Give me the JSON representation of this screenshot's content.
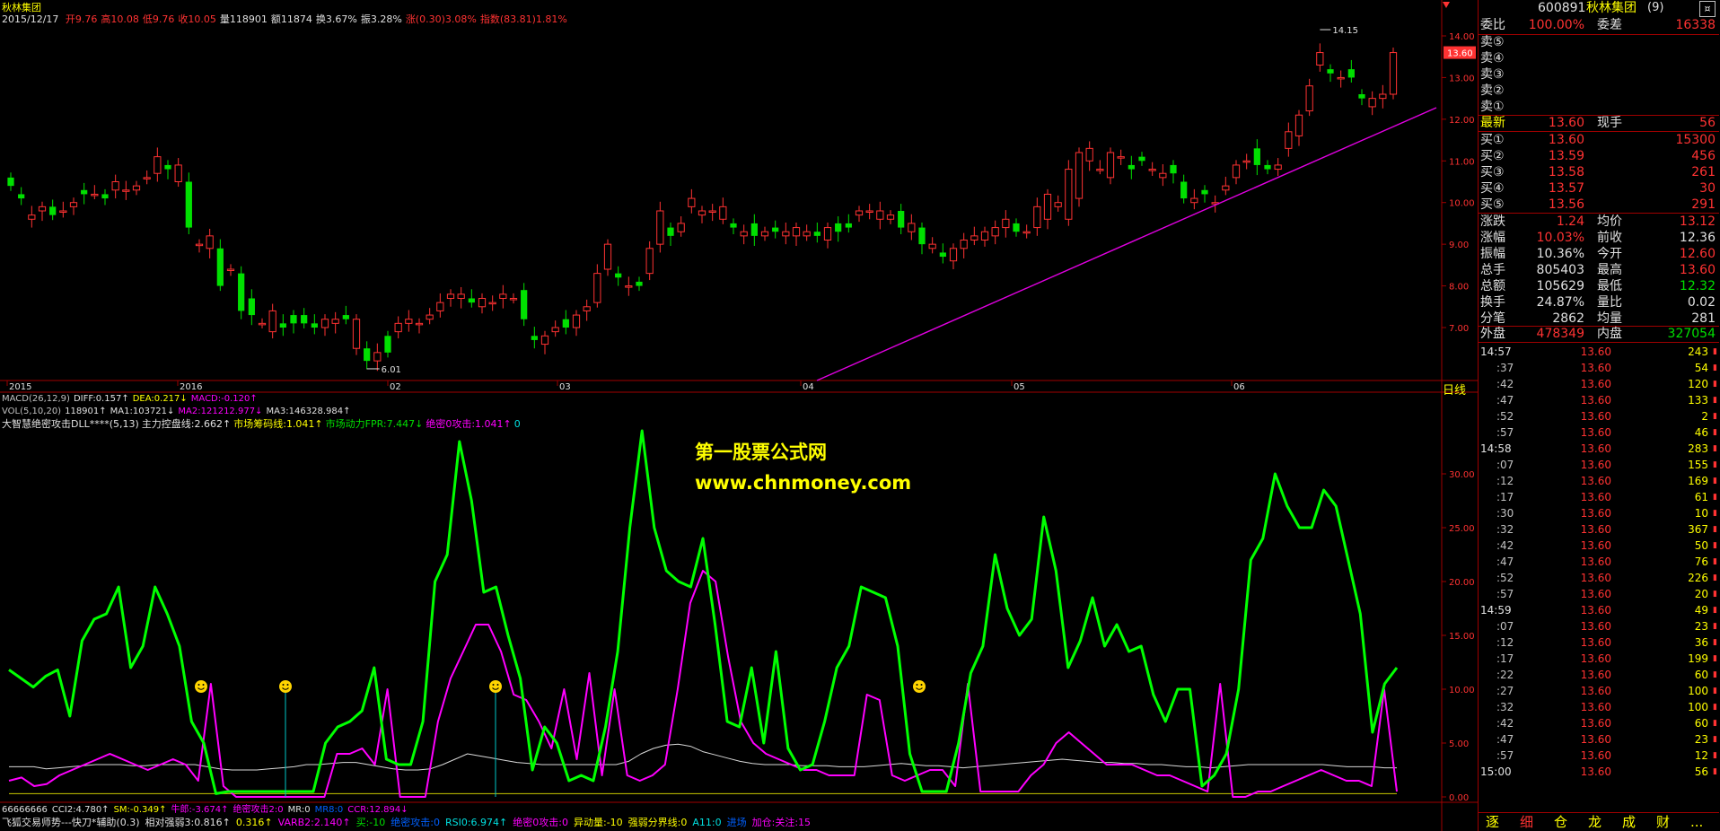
{
  "header": {
    "name": "秋林集团",
    "date": "2015/12/17",
    "fields": [
      {
        "label": "开9.76",
        "color": "#ff3232"
      },
      {
        "label": "高10.08",
        "color": "#ff3232"
      },
      {
        "label": "低9.76",
        "color": "#ff3232"
      },
      {
        "label": "收10.05",
        "color": "#ff3232"
      },
      {
        "label": "量118901",
        "color": "#e0e0e0"
      },
      {
        "label": "额11874",
        "color": "#e0e0e0"
      },
      {
        "label": "换3.67%",
        "color": "#e0e0e0"
      },
      {
        "label": "振3.28%",
        "color": "#e0e0e0"
      },
      {
        "label": "涨(0.30)3.08%",
        "color": "#ff3232"
      },
      {
        "label": "指数(83.81)1.81%",
        "color": "#ff3232"
      }
    ]
  },
  "price_axis": {
    "labels": [
      "14.00",
      "13.00",
      "12.00",
      "11.00",
      "10.00",
      "9.00",
      "8.00",
      "7.00"
    ],
    "current_tag": "13.60",
    "high_label": "14.15",
    "low_label": "6.01"
  },
  "date_axis": {
    "labels": [
      "2015",
      "2016",
      "02",
      "03",
      "04",
      "05",
      "06"
    ],
    "period": "日线"
  },
  "macd_line": [
    {
      "text": "MACD(26,12,9)",
      "color": "#c0c0c0"
    },
    {
      "text": "DIFF:0.157↑",
      "color": "#e0e0e0"
    },
    {
      "text": "DEA:0.217↓",
      "color": "#ffff00"
    },
    {
      "text": "MACD:-0.120↑",
      "color": "#ff00ff"
    }
  ],
  "vol_line": [
    {
      "text": "VOL(5,10,20)",
      "color": "#c0c0c0"
    },
    {
      "text": "118901↑",
      "color": "#e0e0e0"
    },
    {
      "text": "MA1:103721↓",
      "color": "#e0e0e0"
    },
    {
      "text": "MA2:121212.977↓",
      "color": "#ff00ff"
    },
    {
      "text": "MA3:146328.984↑",
      "color": "#e0e0e0"
    }
  ],
  "indicator_line": [
    {
      "text": "大智慧绝密攻击DLL****(5,13)",
      "color": "#e0e0e0"
    },
    {
      "text": "主力控盘线:2.662↑",
      "color": "#e0e0e0"
    },
    {
      "text": "市场筹码线:1.041↑",
      "color": "#ffff00"
    },
    {
      "text": "市场动力FPR:7.447↓",
      "color": "#00e000"
    },
    {
      "text": "绝密0攻击:1.041↑",
      "color": "#ff00ff"
    },
    {
      "text": "0",
      "color": "#00e0e0"
    }
  ],
  "indicator_axis": {
    "labels": [
      "30.00",
      "25.00",
      "20.00",
      "15.00",
      "10.00",
      "5.00",
      "0.00"
    ]
  },
  "watermark": {
    "line1": "第一股票公式网",
    "line2": "www.chnmoney.com"
  },
  "bottom_line1": [
    {
      "text": "66666666",
      "color": "#e0e0e0"
    },
    {
      "text": "CCI2:4.780↑",
      "color": "#e0e0e0"
    },
    {
      "text": "SM:-0.349↑",
      "color": "#ffff00"
    },
    {
      "text": "牛郎:-3.674↑",
      "color": "#ff00ff"
    },
    {
      "text": "绝密攻击2:0",
      "color": "#ff00ff"
    },
    {
      "text": "MR:0",
      "color": "#e0e0e0"
    },
    {
      "text": "MR8:0",
      "color": "#0060ff"
    },
    {
      "text": "CCR:12.894↓",
      "color": "#ff00ff"
    }
  ],
  "bottom_line2": [
    {
      "text": "飞狐交易师势---快刀*辅助(0.3)",
      "color": "#e0e0e0"
    },
    {
      "text": "相对强弱3:0.816↑",
      "color": "#e0e0e0"
    },
    {
      "text": "0.316↑",
      "color": "#ffff00"
    },
    {
      "text": "VARB2:2.140↑",
      "color": "#ff00ff"
    },
    {
      "text": "买:-10",
      "color": "#00e000"
    },
    {
      "text": "绝密攻击:0",
      "color": "#0060ff"
    },
    {
      "text": "RSI0:6.974↑",
      "color": "#00e0e0"
    },
    {
      "text": "绝密0攻击:0",
      "color": "#ff00ff"
    },
    {
      "text": "异动量:-10",
      "color": "#ffff00"
    },
    {
      "text": "强弱分界线:0",
      "color": "#ffff00"
    },
    {
      "text": "A11:0",
      "color": "#00e0e0"
    },
    {
      "text": "进场",
      "color": "#0060ff"
    },
    {
      "text": "加仓:关注:15",
      "color": "#ff00ff"
    }
  ],
  "right_panel": {
    "code": "600891",
    "name": "秋林集团",
    "suffix": "(9)",
    "corner": "¤",
    "weibi_label": "委比",
    "weibi_value": "100.00%",
    "weicha_label": "委差",
    "weicha_value": "16338",
    "sell_levels": [
      "卖⑤",
      "卖④",
      "卖③",
      "卖②",
      "卖①"
    ],
    "latest": {
      "label": "最新",
      "value": "13.60",
      "label2": "现手",
      "value2": "56"
    },
    "buy_levels": [
      {
        "label": "买①",
        "price": "13.60",
        "vol": "15300"
      },
      {
        "label": "买②",
        "price": "13.59",
        "vol": "456"
      },
      {
        "label": "买③",
        "price": "13.58",
        "vol": "261"
      },
      {
        "label": "买④",
        "price": "13.57",
        "vol": "30"
      },
      {
        "label": "买⑤",
        "price": "13.56",
        "vol": "291"
      }
    ],
    "stats": [
      {
        "l1": "涨跌",
        "v1": "1.24",
        "c1": "#ff3232",
        "l2": "均价",
        "v2": "13.12",
        "c2": "#ff3232"
      },
      {
        "l1": "涨幅",
        "v1": "10.03%",
        "c1": "#ff3232",
        "l2": "前收",
        "v2": "12.36",
        "c2": "#e0e0e0"
      },
      {
        "l1": "振幅",
        "v1": "10.36%",
        "c1": "#e0e0e0",
        "l2": "今开",
        "v2": "12.60",
        "c2": "#ff3232"
      },
      {
        "l1": "总手",
        "v1": "805403",
        "c1": "#e0e0e0",
        "l2": "最高",
        "v2": "13.60",
        "c2": "#ff3232"
      },
      {
        "l1": "总额",
        "v1": "105629",
        "c1": "#e0e0e0",
        "l2": "最低",
        "v2": "12.32",
        "c2": "#00e000"
      },
      {
        "l1": "换手",
        "v1": "24.87%",
        "c1": "#e0e0e0",
        "l2": "量比",
        "v2": "0.02",
        "c2": "#e0e0e0"
      },
      {
        "l1": "分笔",
        "v1": "2862",
        "c1": "#e0e0e0",
        "l2": "均量",
        "v2": "281",
        "c2": "#e0e0e0"
      }
    ],
    "outer": {
      "label": "外盘",
      "value": "478349",
      "label2": "内盘",
      "value2": "327054"
    },
    "ticks": [
      {
        "t": "14:57",
        "p": "13.60",
        "v": "243",
        "up": true,
        "main": true
      },
      {
        "t": ":37",
        "p": "13.60",
        "v": "54",
        "up": true
      },
      {
        "t": ":42",
        "p": "13.60",
        "v": "120",
        "up": true
      },
      {
        "t": ":47",
        "p": "13.60",
        "v": "133",
        "up": true
      },
      {
        "t": ":52",
        "p": "13.60",
        "v": "2",
        "up": true
      },
      {
        "t": ":57",
        "p": "13.60",
        "v": "46",
        "up": true
      },
      {
        "t": "14:58",
        "p": "13.60",
        "v": "283",
        "up": true,
        "main": true
      },
      {
        "t": ":07",
        "p": "13.60",
        "v": "155",
        "up": true
      },
      {
        "t": ":12",
        "p": "13.60",
        "v": "169",
        "up": true
      },
      {
        "t": ":17",
        "p": "13.60",
        "v": "61",
        "up": true
      },
      {
        "t": ":30",
        "p": "13.60",
        "v": "10",
        "up": true
      },
      {
        "t": ":32",
        "p": "13.60",
        "v": "367",
        "up": true
      },
      {
        "t": ":42",
        "p": "13.60",
        "v": "50",
        "up": true
      },
      {
        "t": ":47",
        "p": "13.60",
        "v": "76",
        "up": true
      },
      {
        "t": ":52",
        "p": "13.60",
        "v": "226",
        "up": true
      },
      {
        "t": ":57",
        "p": "13.60",
        "v": "20",
        "up": true
      },
      {
        "t": "14:59",
        "p": "13.60",
        "v": "49",
        "up": true,
        "main": true
      },
      {
        "t": ":07",
        "p": "13.60",
        "v": "23",
        "up": true
      },
      {
        "t": ":12",
        "p": "13.60",
        "v": "36",
        "up": true
      },
      {
        "t": ":17",
        "p": "13.60",
        "v": "199",
        "up": true
      },
      {
        "t": ":22",
        "p": "13.60",
        "v": "60",
        "up": true
      },
      {
        "t": ":27",
        "p": "13.60",
        "v": "100",
        "up": true
      },
      {
        "t": ":32",
        "p": "13.60",
        "v": "100",
        "up": true
      },
      {
        "t": ":42",
        "p": "13.60",
        "v": "60",
        "up": true
      },
      {
        "t": ":47",
        "p": "13.60",
        "v": "23",
        "up": true
      },
      {
        "t": ":57",
        "p": "13.60",
        "v": "12",
        "up": true
      },
      {
        "t": "15:00",
        "p": "13.60",
        "v": "56",
        "up": true,
        "main": true
      }
    ],
    "tabs": [
      "逐",
      "细",
      "仓",
      "龙",
      "成",
      "财",
      "..."
    ]
  },
  "chart_data": {
    "type": "candlestick",
    "ylim": [
      6.0,
      14.5
    ],
    "candles": [
      [
        10.6,
        10.4
      ],
      [
        10.2,
        10.1
      ],
      [
        9.6,
        9.7
      ],
      [
        9.8,
        9.9
      ],
      [
        9.9,
        9.7
      ],
      [
        9.8,
        9.8
      ],
      [
        9.9,
        10.0
      ],
      [
        10.3,
        10.2
      ],
      [
        10.2,
        10.2
      ],
      [
        10.2,
        10.1
      ],
      [
        10.3,
        10.5
      ],
      [
        10.3,
        10.3
      ],
      [
        10.3,
        10.4
      ],
      [
        10.6,
        10.6
      ],
      [
        10.7,
        11.1
      ],
      [
        10.9,
        10.8
      ],
      [
        10.5,
        10.9
      ],
      [
        10.5,
        9.4
      ],
      [
        9.0,
        9.0
      ],
      [
        8.9,
        9.2
      ],
      [
        8.9,
        8.0
      ],
      [
        8.4,
        8.4
      ],
      [
        8.3,
        7.4
      ],
      [
        7.7,
        7.3
      ],
      [
        7.1,
        7.1
      ],
      [
        6.9,
        7.4
      ],
      [
        7.1,
        7.0
      ],
      [
        7.3,
        7.1
      ],
      [
        7.3,
        7.1
      ],
      [
        7.1,
        7.0
      ],
      [
        7.0,
        7.2
      ],
      [
        7.1,
        7.2
      ],
      [
        7.3,
        7.2
      ],
      [
        6.5,
        7.2
      ],
      [
        6.5,
        6.2
      ],
      [
        6.2,
        6.4
      ],
      [
        6.8,
        6.4
      ],
      [
        6.9,
        7.1
      ],
      [
        7.1,
        7.2
      ],
      [
        7.1,
        7.1
      ],
      [
        7.2,
        7.3
      ],
      [
        7.4,
        7.6
      ],
      [
        7.7,
        7.8
      ],
      [
        7.7,
        7.8
      ],
      [
        7.7,
        7.6
      ],
      [
        7.5,
        7.7
      ],
      [
        7.6,
        7.6
      ],
      [
        7.7,
        7.8
      ],
      [
        7.7,
        7.7
      ],
      [
        7.9,
        7.2
      ],
      [
        6.8,
        6.7
      ],
      [
        6.6,
        6.8
      ],
      [
        6.9,
        7.0
      ],
      [
        7.2,
        7.0
      ],
      [
        7.0,
        7.3
      ],
      [
        7.4,
        7.5
      ],
      [
        7.6,
        8.3
      ],
      [
        8.4,
        9.0
      ],
      [
        8.3,
        8.2
      ],
      [
        8.0,
        8.0
      ],
      [
        8.1,
        8.0
      ],
      [
        8.3,
        8.9
      ],
      [
        9.0,
        9.8
      ],
      [
        9.4,
        9.2
      ],
      [
        9.3,
        9.5
      ],
      [
        9.9,
        10.1
      ],
      [
        9.7,
        9.8
      ],
      [
        9.8,
        9.8
      ],
      [
        9.6,
        9.9
      ],
      [
        9.5,
        9.4
      ],
      [
        9.2,
        9.3
      ],
      [
        9.5,
        9.2
      ],
      [
        9.2,
        9.3
      ],
      [
        9.4,
        9.3
      ],
      [
        9.2,
        9.3
      ],
      [
        9.2,
        9.4
      ],
      [
        9.2,
        9.3
      ],
      [
        9.3,
        9.2
      ],
      [
        9.1,
        9.4
      ],
      [
        9.5,
        9.3
      ],
      [
        9.5,
        9.4
      ],
      [
        9.7,
        9.8
      ],
      [
        9.8,
        9.8
      ],
      [
        9.6,
        9.8
      ],
      [
        9.6,
        9.7
      ],
      [
        9.8,
        9.4
      ],
      [
        9.3,
        9.5
      ],
      [
        9.4,
        9.0
      ],
      [
        8.9,
        9.0
      ],
      [
        8.8,
        8.7
      ],
      [
        8.6,
        8.9
      ],
      [
        8.9,
        9.1
      ],
      [
        9.1,
        9.2
      ],
      [
        9.1,
        9.3
      ],
      [
        9.2,
        9.4
      ],
      [
        9.4,
        9.6
      ],
      [
        9.5,
        9.3
      ],
      [
        9.3,
        9.3
      ],
      [
        9.4,
        9.9
      ],
      [
        9.6,
        10.2
      ],
      [
        9.9,
        10.0
      ],
      [
        9.6,
        10.8
      ],
      [
        10.1,
        11.2
      ],
      [
        11.0,
        11.3
      ],
      [
        10.8,
        10.8
      ],
      [
        10.6,
        11.2
      ],
      [
        11.1,
        11.1
      ],
      [
        10.9,
        10.8
      ],
      [
        11.1,
        11.0
      ],
      [
        10.8,
        10.8
      ],
      [
        10.6,
        10.7
      ],
      [
        10.9,
        10.7
      ],
      [
        10.5,
        10.1
      ],
      [
        10.0,
        10.1
      ],
      [
        10.3,
        10.2
      ],
      [
        10.0,
        10.0
      ],
      [
        10.3,
        10.4
      ],
      [
        10.6,
        10.9
      ],
      [
        11.0,
        11.0
      ],
      [
        11.3,
        10.9
      ],
      [
        10.9,
        10.8
      ],
      [
        10.8,
        10.9
      ],
      [
        11.3,
        11.7
      ],
      [
        11.6,
        12.1
      ],
      [
        12.2,
        12.8
      ],
      [
        13.3,
        13.6
      ],
      [
        13.2,
        13.1
      ],
      [
        13.0,
        13.0
      ],
      [
        13.2,
        13.0
      ],
      [
        12.6,
        12.5
      ],
      [
        12.3,
        12.5
      ],
      [
        12.5,
        12.6
      ],
      [
        12.6,
        13.6
      ]
    ],
    "indicator": {
      "green": [
        11.8,
        11,
        10.2,
        11.2,
        11.8,
        7.5,
        14.5,
        16.5,
        17,
        19.5,
        12,
        14,
        19.5,
        17,
        14,
        7,
        5,
        0.3,
        0.5,
        0.5,
        0.5,
        0.5,
        0.5,
        0.5,
        0.5,
        0.5,
        5,
        6.5,
        7,
        8,
        12,
        3.5,
        3,
        3,
        7,
        20,
        22.5,
        33,
        27.5,
        19,
        19.5,
        15,
        11,
        2.5,
        6.5,
        5,
        1.5,
        2,
        1.5,
        6.5,
        13.5,
        25,
        34,
        25,
        21,
        20,
        19.5,
        24,
        16,
        7,
        6.5,
        12,
        5,
        13.5,
        4.5,
        2.5,
        3,
        7,
        12,
        14,
        19.5,
        19,
        18.5,
        14,
        4,
        0.5,
        0.5,
        0.5,
        5,
        11.5,
        14,
        22.5,
        17.5,
        15,
        16.5,
        26,
        21,
        12,
        14.5,
        18.5,
        14,
        16,
        13.5,
        14,
        9.5,
        7,
        10,
        10,
        1,
        2,
        4,
        10,
        22,
        24,
        30,
        27,
        25,
        25,
        28.5,
        27,
        22,
        17,
        6,
        10.5,
        12
      ],
      "magenta": [
        1.5,
        1.8,
        1,
        1.2,
        2,
        2.5,
        3,
        3.5,
        4,
        3.5,
        3,
        2.5,
        3,
        3.5,
        3,
        1.5,
        10.5,
        1,
        0,
        0,
        0,
        0,
        0,
        0,
        0,
        0,
        4,
        4,
        4.5,
        3,
        10,
        0,
        0,
        0,
        7,
        11,
        13.5,
        16,
        16,
        13.5,
        9.5,
        9,
        7,
        4.5,
        10,
        3.5,
        11.5,
        2,
        10,
        2,
        1.5,
        2,
        3,
        10,
        18,
        21,
        20,
        13,
        7,
        5,
        4,
        3.5,
        3,
        2.5,
        2.5,
        2,
        2,
        2,
        9.5,
        9,
        2,
        1.5,
        2,
        2.5,
        2.5,
        1,
        10.5,
        0.5,
        0.5,
        0.5,
        0.5,
        2,
        3,
        5,
        6,
        5,
        4,
        3,
        3,
        3,
        2.5,
        2,
        2,
        1.5,
        1,
        0.5,
        10.5,
        0,
        0,
        0.5,
        0.5,
        1,
        1.5,
        2,
        2.5,
        2,
        1.5,
        1.5,
        1,
        10,
        0.5
      ],
      "white": [
        2.8,
        2.8,
        2.8,
        2.6,
        2.7,
        2.8,
        2.9,
        3,
        3,
        3,
        2.9,
        2.9,
        3,
        3,
        3,
        3,
        2.8,
        2.6,
        2.5,
        2.5,
        2.5,
        2.6,
        2.7,
        2.8,
        3,
        3,
        3.1,
        3.2,
        3.2,
        3,
        2.8,
        2.6,
        2.5,
        2.5,
        2.6,
        3,
        3.5,
        4,
        3.8,
        3.6,
        3.4,
        3.2,
        3.1,
        3,
        3,
        3,
        3,
        3,
        3,
        3,
        3.3,
        4,
        4.5,
        4.8,
        4.9,
        4.7,
        4.2,
        3.9,
        3.6,
        3.3,
        3.1,
        3,
        3,
        3,
        2.9,
        2.9,
        2.9,
        2.8,
        2.8,
        2.8,
        2.9,
        3,
        3.1,
        3,
        2.9,
        2.9,
        2.8,
        2.7,
        2.8,
        2.9,
        3,
        3.1,
        3.2,
        3.3,
        3.4,
        3.5,
        3.4,
        3.3,
        3.2,
        3.2,
        3.1,
        3.1,
        3,
        3,
        2.9,
        2.8,
        2.8,
        2.7,
        2.8,
        2.9,
        3,
        3,
        3,
        3,
        3,
        3,
        3,
        2.9,
        2.8,
        2.8,
        2.8,
        2.7,
        2.7
      ]
    }
  }
}
